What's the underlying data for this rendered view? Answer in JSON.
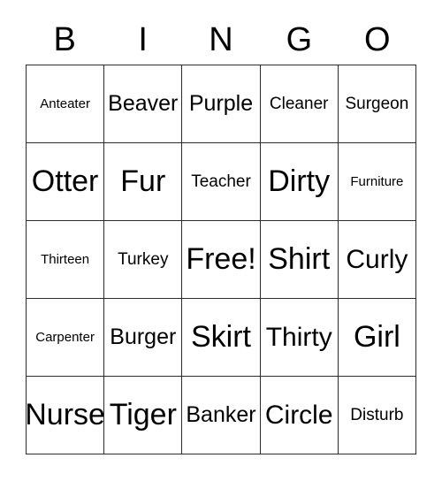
{
  "header": {
    "letters": [
      "B",
      "I",
      "N",
      "G",
      "O"
    ]
  },
  "grid": {
    "columns": 5,
    "rows": 5,
    "cells": [
      {
        "label": "Anteater",
        "size": "xs"
      },
      {
        "label": "Beaver",
        "size": "md"
      },
      {
        "label": "Purple",
        "size": "md"
      },
      {
        "label": "Cleaner",
        "size": "sm"
      },
      {
        "label": "Surgeon",
        "size": "sm"
      },
      {
        "label": "Otter",
        "size": "xl"
      },
      {
        "label": "Fur",
        "size": "xl"
      },
      {
        "label": "Teacher",
        "size": "sm"
      },
      {
        "label": "Dirty",
        "size": "xl"
      },
      {
        "label": "Furniture",
        "size": "xs"
      },
      {
        "label": "Thirteen",
        "size": "xs"
      },
      {
        "label": "Turkey",
        "size": "sm"
      },
      {
        "label": "Free!",
        "size": "xl"
      },
      {
        "label": "Shirt",
        "size": "xl"
      },
      {
        "label": "Curly",
        "size": "lg"
      },
      {
        "label": "Carpenter",
        "size": "xs"
      },
      {
        "label": "Burger",
        "size": "md"
      },
      {
        "label": "Skirt",
        "size": "xl"
      },
      {
        "label": "Thirty",
        "size": "lg"
      },
      {
        "label": "Girl",
        "size": "xl"
      },
      {
        "label": "Nurse",
        "size": "xl"
      },
      {
        "label": "Tiger",
        "size": "xl"
      },
      {
        "label": "Banker",
        "size": "md"
      },
      {
        "label": "Circle",
        "size": "lg"
      },
      {
        "label": "Disturb",
        "size": "sm"
      }
    ]
  },
  "style": {
    "background_color": "#ffffff",
    "text_color": "#000000",
    "border_color": "#2b2b2b"
  }
}
